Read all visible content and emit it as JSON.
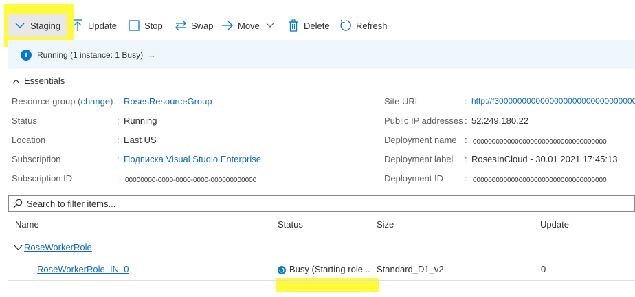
{
  "toolbar": {
    "staging_label": "Staging",
    "update_label": "Update",
    "stop_label": "Stop",
    "swap_label": "Swap",
    "move_label": "Move",
    "delete_label": "Delete",
    "refresh_label": "Refresh"
  },
  "banner": {
    "text": "Running (1 instance: 1 Busy)",
    "arrow": "→"
  },
  "essentials": {
    "title": "Essentials",
    "left": {
      "resource_group_label": "Resource group (",
      "change_link": "change",
      "resource_group_label_end": ")",
      "resource_group_value": "RosesResourceGroup",
      "status_label": "Status",
      "status_value": "Running",
      "location_label": "Location",
      "location_value": "East US",
      "subscription_label": "Subscription",
      "subscription_value": "Подписка Visual Studio Enterprise",
      "subscription_id_label": "Subscription ID",
      "subscription_id_value": "00000000-0000-0000-0000-000000000000"
    },
    "right": {
      "site_url_label": "Site URL",
      "site_url_value": "http://f30000000000000000000000000000000",
      "public_ip_label": "Public IP addresses",
      "public_ip_value": "52.249.180.22",
      "deployment_name_label": "Deployment name",
      "deployment_name_value": "00000000000000000000000000000000000",
      "deployment_label_label": "Deployment label",
      "deployment_label_value": "RosesInCloud - 30.01.2021 17:45:13",
      "deployment_id_label": "Deployment ID",
      "deployment_id_value": "00000000000000000000000000000000000"
    },
    "separator": ":"
  },
  "search": {
    "placeholder": "Search to filter items..."
  },
  "table": {
    "headers": {
      "name": "Name",
      "status": "Status",
      "size": "Size",
      "update": "Update"
    },
    "group_name": "RoseWorkerRole",
    "row": {
      "name": "RoseWorkerRole_IN_0",
      "status": "Busy (Starting role...",
      "size": "Standard_D1_v2",
      "update": "0"
    }
  },
  "colors": {
    "accent": "#0078d4",
    "link": "#0f6cbd",
    "highlight": "#fffb3a",
    "banner_bg": "#eff6fc"
  }
}
